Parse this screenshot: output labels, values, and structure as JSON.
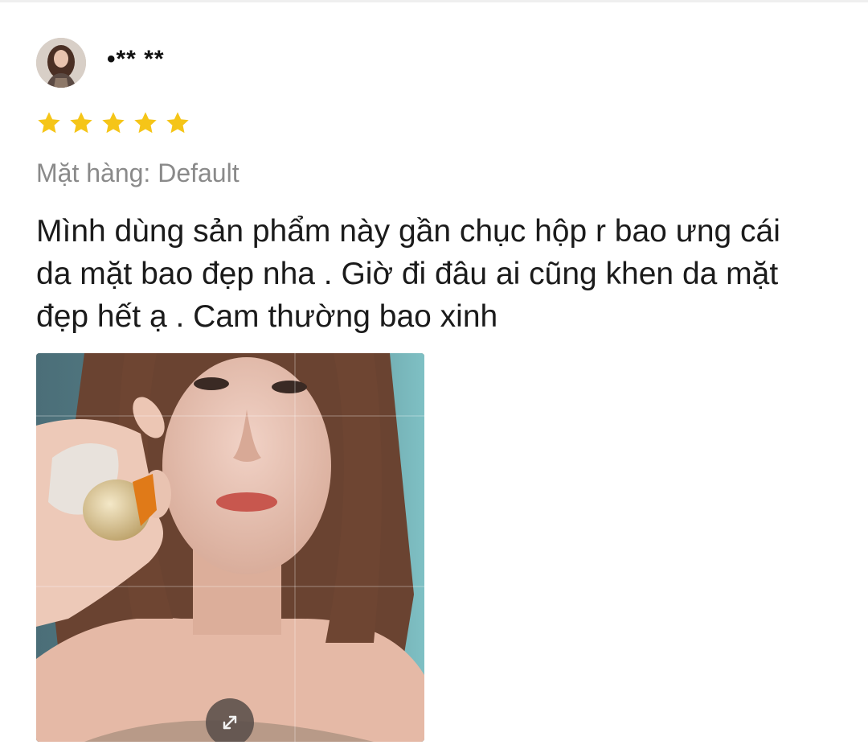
{
  "review": {
    "username": "•** **",
    "rating": 5,
    "rating_max": 5,
    "variant_label": "Mặt hàng: Default",
    "comment": "Mình dùng sản phẩm này gần chục hộp r bao ưng cái da mặt bao đẹp nha . Giờ đi đâu ai cũng khen da mặt đẹp hết ạ . Cam thường bao xinh",
    "star_color": "#f5c518",
    "avatar_icon": "user-avatar-photo",
    "expand_icon": "expand-arrows-icon"
  }
}
